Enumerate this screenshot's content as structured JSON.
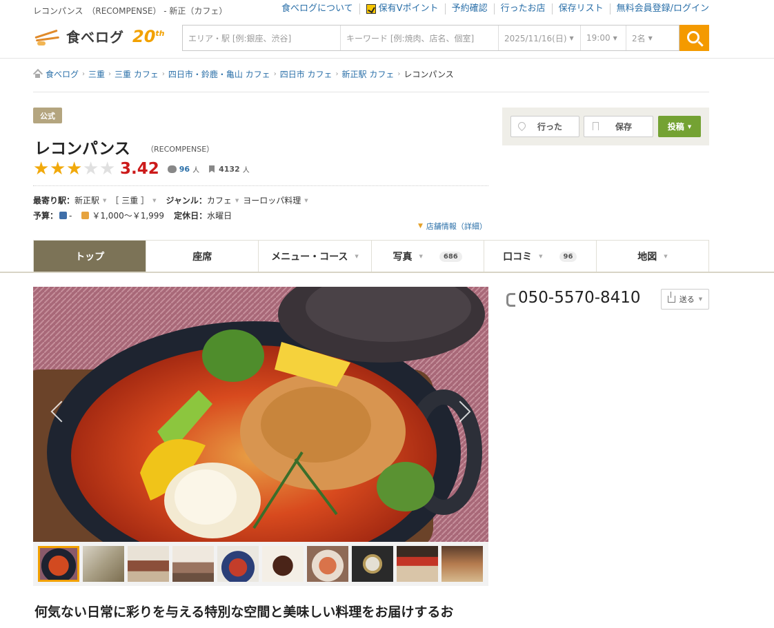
{
  "topbar": {
    "shop_crumb": "レコンパンス　（RECOMPENSE） - 新正（カフェ）",
    "links": [
      "食べログについて",
      "保有Vポイント",
      "予約確認",
      "行ったお店",
      "保存リスト",
      "無料会員登録/ログイン"
    ]
  },
  "header": {
    "logo_text": "食べログ",
    "logo_anniversary": "20",
    "logo_anniversary_suffix": "th",
    "search": {
      "area_placeholder": "エリア・駅 [例:銀座、渋谷]",
      "keyword_placeholder": "キーワード [例:焼肉、店名、個室]",
      "date": "2025/11/16(日)",
      "time": "19:00",
      "people": "2名"
    }
  },
  "breadcrumb": [
    "食べログ",
    "三重",
    "三重 カフェ",
    "四日市・鈴鹿・亀山 カフェ",
    "四日市 カフェ",
    "新正駅 カフェ",
    "レコンパンス"
  ],
  "shop": {
    "official_badge": "公式",
    "name": "レコンパンス",
    "name_en": "（RECOMPENSE）",
    "rating": 3.42,
    "rating_text": "3.42",
    "stars_filled": 3,
    "reviews": "96",
    "reviews_unit": "人",
    "saves": "4132",
    "saves_unit": "人",
    "station_label": "最寄り駅：",
    "station": "新正駅",
    "pref": "［ 三重 ］",
    "genre_label": "ジャンル：",
    "genre_1": "カフェ",
    "genre_2": "ヨーロッパ料理",
    "budget_label": "予算：",
    "budget_night": "-",
    "budget_day": "￥1,000～￥1,999",
    "holiday_label": "定休日：",
    "holiday": "水曜日",
    "detail_link": "店舗情報（詳細）"
  },
  "actions": {
    "went": "行った",
    "save": "保存",
    "post": "投稿"
  },
  "tabs": [
    {
      "label": "トップ"
    },
    {
      "label": "座席"
    },
    {
      "label": "メニュー・コース"
    },
    {
      "label": "写真",
      "badge": "686"
    },
    {
      "label": "口コミ",
      "badge": "96"
    },
    {
      "label": "地図"
    }
  ],
  "sidebar": {
    "phone": "050-5570-8410",
    "send": "送る"
  },
  "headline": "何気ない日常に彩りを与える特別な空間と美味しい料理をお届けするお"
}
